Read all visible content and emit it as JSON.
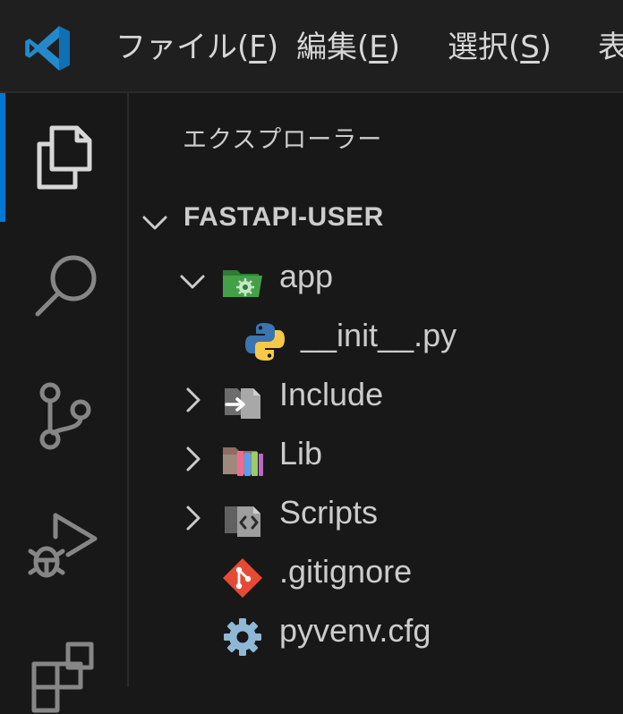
{
  "menu": {
    "items": [
      {
        "label": "ファイル(",
        "key": "F",
        "suffix": ")"
      },
      {
        "label": "編集(",
        "key": "E",
        "suffix": ")"
      },
      {
        "label": "選択(",
        "key": "S",
        "suffix": ")"
      },
      {
        "label": "表",
        "key": "",
        "suffix": ""
      }
    ]
  },
  "activity_bar": {
    "icons": [
      "explorer-icon",
      "search-icon",
      "source-control-icon",
      "run-debug-icon",
      "extensions-icon"
    ]
  },
  "explorer": {
    "title": "エクスプローラー",
    "section_label": "FASTAPI-USER",
    "tree": [
      {
        "name": "app",
        "type": "folder-open",
        "icon": "folder-app-icon"
      },
      {
        "name": "__init__.py",
        "type": "file",
        "icon": "python-icon"
      },
      {
        "name": "Include",
        "type": "folder",
        "icon": "folder-include-icon"
      },
      {
        "name": "Lib",
        "type": "folder",
        "icon": "folder-lib-icon"
      },
      {
        "name": "Scripts",
        "type": "folder",
        "icon": "folder-scripts-icon"
      },
      {
        "name": ".gitignore",
        "type": "file",
        "icon": "git-icon"
      },
      {
        "name": "pyvenv.cfg",
        "type": "file",
        "icon": "settings-gear-icon"
      }
    ]
  },
  "colors": {
    "accent": "#0078d4",
    "background": "#181818",
    "text": "#cccccc"
  }
}
